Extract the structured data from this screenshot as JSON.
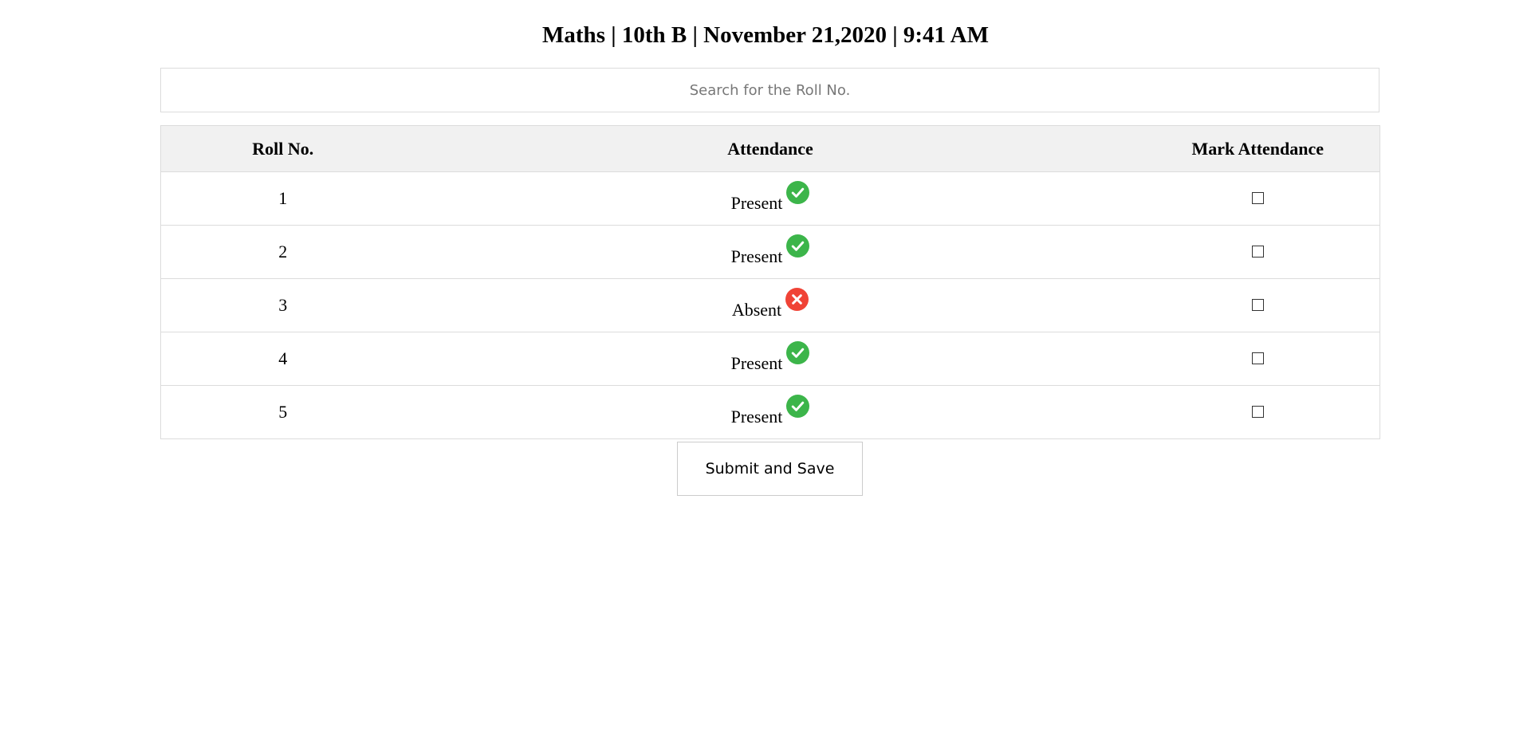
{
  "header": {
    "title": "Maths | 10th B | November 21,2020 | 9:41 AM"
  },
  "search": {
    "placeholder": "Search for the Roll No.",
    "value": ""
  },
  "table": {
    "headers": {
      "roll": "Roll No.",
      "attendance": "Attendance",
      "mark": "Mark Attendance"
    },
    "rows": [
      {
        "roll": "1",
        "status": "Present",
        "icon": "check-circle-icon",
        "checked": false
      },
      {
        "roll": "2",
        "status": "Present",
        "icon": "check-circle-icon",
        "checked": false
      },
      {
        "roll": "3",
        "status": "Absent",
        "icon": "cross-circle-icon",
        "checked": false
      },
      {
        "roll": "4",
        "status": "Present",
        "icon": "check-circle-icon",
        "checked": false
      },
      {
        "roll": "5",
        "status": "Present",
        "icon": "check-circle-icon",
        "checked": false
      }
    ]
  },
  "actions": {
    "submit_label": "Submit and Save"
  },
  "colors": {
    "present": "#3cb54a",
    "absent": "#f04336",
    "header_bg": "#f1f1f1",
    "border": "#dcdcdc"
  }
}
